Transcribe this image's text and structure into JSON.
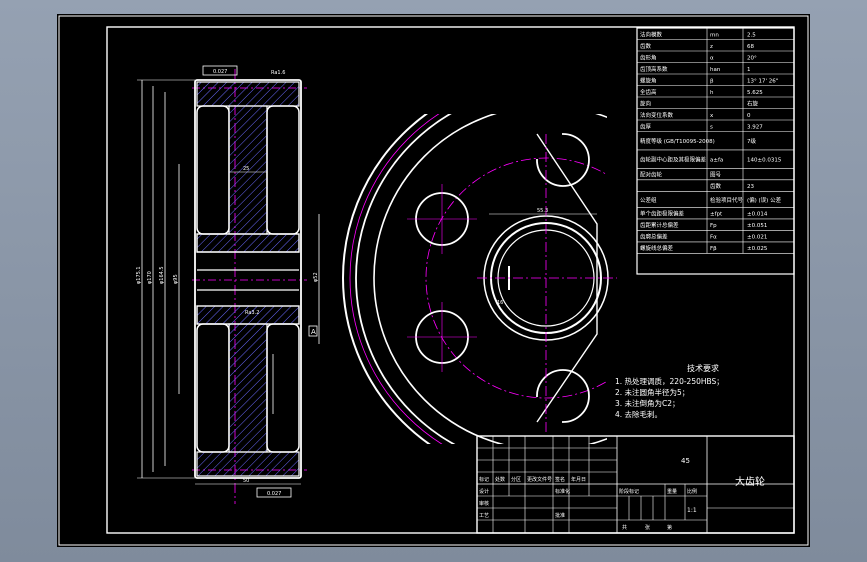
{
  "params_table": {
    "rows": [
      {
        "name": "法向模数",
        "symbol": "mn",
        "value": "2.5"
      },
      {
        "name": "齿数",
        "symbol": "z",
        "value": "68"
      },
      {
        "name": "齿形角",
        "symbol": "α",
        "value": "20°"
      },
      {
        "name": "齿顶高系数",
        "symbol": "han",
        "value": "1"
      },
      {
        "name": "螺旋角",
        "symbol": "β",
        "value": "13° 17' 26\""
      },
      {
        "name": "全齿高",
        "symbol": "h",
        "value": "5.625"
      },
      {
        "name": "旋向",
        "symbol": "",
        "value": "右旋"
      },
      {
        "name": "法向变位系数",
        "symbol": "x",
        "value": "0"
      },
      {
        "name": "齿厚",
        "symbol": "s",
        "value": "3.927"
      },
      {
        "name": "精度等级 (GB/T10095-2008)",
        "symbol": "",
        "value": "7级"
      },
      {
        "name": "齿轮副中心距及其极限偏差",
        "symbol": "a±fa",
        "value": "140±0.0315"
      },
      {
        "name": "配对齿轮",
        "symbol": "图号",
        "value": ""
      },
      {
        "name": "",
        "symbol": "齿数",
        "value": "23"
      },
      {
        "name": "公差组",
        "symbol": "检验项目代号",
        "value": "(偏) (误) 公差"
      },
      {
        "name": "单个齿距极限偏差",
        "symbol": "±fpt",
        "value": "±0.014"
      },
      {
        "name": "齿距累计总偏差",
        "symbol": "Fp",
        "value": "±0.051"
      },
      {
        "name": "齿廓总偏差",
        "symbol": "Fα",
        "value": "±0.021"
      },
      {
        "name": "螺旋线总偏差",
        "symbol": "Fβ",
        "value": "±0.025"
      }
    ]
  },
  "tech_notes": {
    "title": "技术要求",
    "items": [
      "1. 热处理调质，220-250HBS；",
      "2. 未注圆角半径为5；",
      "3. 未注倒角为C2；",
      "4. 去除毛刺。"
    ]
  },
  "title_block": {
    "drawing_name": "大齿轮",
    "material": "45",
    "scale": "1:1",
    "labels": {
      "mark": "标记",
      "count": "处数",
      "zone": "分区",
      "change_doc": "更改文件号",
      "sign": "签名",
      "date": "年月日",
      "design": "设计",
      "standardize": "标准化",
      "stage_mark": "阶段标记",
      "weight": "重量",
      "ratio": "比例",
      "review": "审核",
      "process": "工艺",
      "approve": "批准",
      "sheets_total": "共",
      "sheet": "张",
      "sheet_no": "第"
    }
  },
  "dims": {
    "da": "φ175.1",
    "d": "φ170",
    "df": "φ164.5",
    "hub_d": "φ95",
    "bore_d": "φ52",
    "ra_top": "Ra1.6",
    "ra_mid": "Ra3.2",
    "datum": "A",
    "gdt_top": "0.027",
    "gdt_bot": "0.027",
    "width": "50",
    "hub_w": "25",
    "keyway": "55.3",
    "key_w": "16"
  },
  "colors": {
    "bg": "#000000",
    "line": "#ffffff",
    "center": "#ff00ff",
    "window": "#8c98a8"
  }
}
